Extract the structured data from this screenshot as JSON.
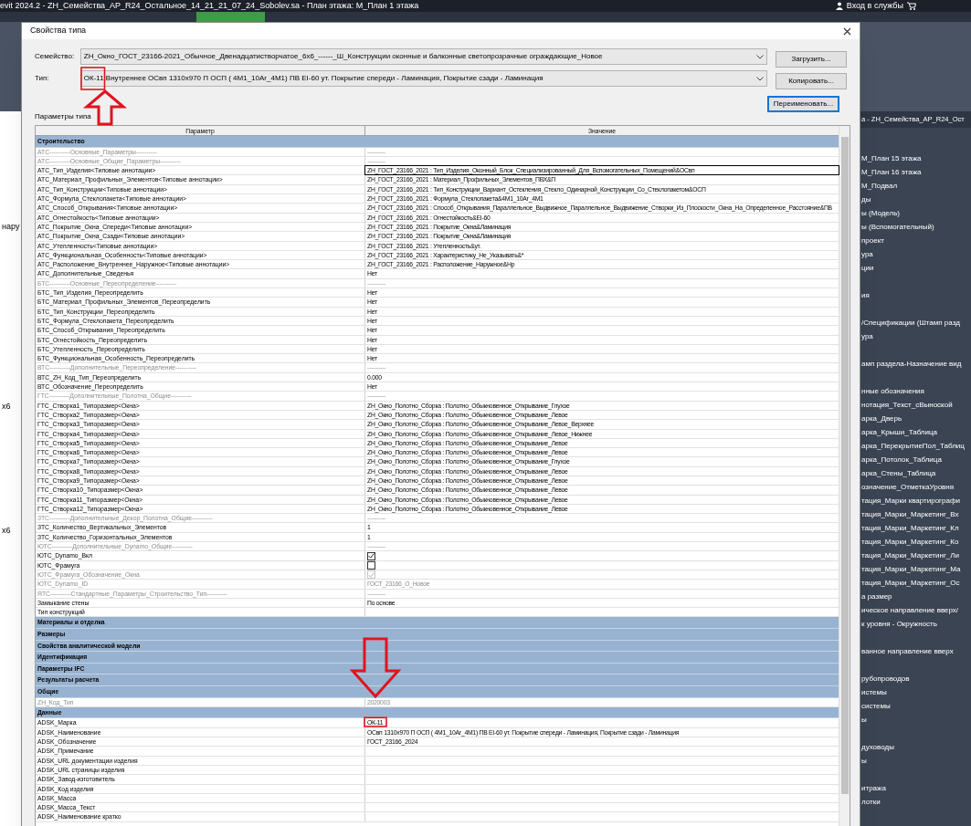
{
  "app": {
    "title": "evit 2024.2 - ZH_Семейства_АР_R24_Остальное_14_21_21_07_24_Sobolev.sa - План этажа: М_План 1 этажа",
    "sign_in": "Вход в службы"
  },
  "canvas": {
    "labels": [
      "нару",
      "х6",
      "х6"
    ]
  },
  "project_browser": {
    "header": "a - ZH_Семейства_АР_R24_Ост",
    "sections": [
      [
        "М_План 15 этажа",
        "М_План 16 этажа",
        "М_Подвал",
        "ды",
        "ы (Модель)",
        "ы (Вспомогательный)",
        "проект",
        "ура",
        "ции"
      ],
      [
        "ия"
      ],
      [
        "/Спецификации (Штамп разд",
        "ура"
      ],
      [
        "амп раздела-Назначение вид"
      ],
      [
        "нные обозначения",
        "нотация_Текст_сВыноской",
        "арка_Дверь",
        "арка_Крыши_Таблица",
        "арка_ПерекрытиеПол_Таблиц",
        "арка_Потолок_Таблица",
        "арка_Стены_Таблица",
        "означение_ОтметкаУровня",
        "тация_Марки квартирографи",
        "тация_Марки_Маркетинг_Вх",
        "тация_Марки_Маркетинг_Кл",
        "тация_Марки_Маркетинг_Ко",
        "тация_Марки_Маркетинг_Ли",
        "тация_Марки_Маркетинг_Ма",
        "тация_Марки_Маркетинг_Ос",
        "а размер",
        "ическое направление вверх/",
        "к уровня - Окружность"
      ],
      [
        "ванное направление вверх"
      ],
      [
        "рубопроводов",
        "истемы",
        "системы",
        "ы"
      ],
      [
        "духоводы",
        "ы"
      ],
      [
        "итража",
        "лотки"
      ]
    ]
  },
  "dialog": {
    "title": "Свойства типа",
    "family": {
      "label": "Семейство:",
      "value": "ZH_Окно_ГОСТ_23166-2021_Обычное_Двенадцатистворчатое_6х6_------_Ш_Конструкции оконные и балконные светопрозрачные ограждающие_Новое"
    },
    "type": {
      "label": "Тип:",
      "value": "ОК-11 Внутреннее ОСвп 1310х970 П ОСП ( 4М1_10Ar_4М1) ПВ EI-60 ут.  Покрытие спереди - Ламинация, Покрытие сзади - Ламинация"
    },
    "buttons": [
      {
        "label": "Загрузить...",
        "default": false
      },
      {
        "label": "Копировать...",
        "default": false
      },
      {
        "label": "Переименовать...",
        "default": true
      }
    ],
    "params_label": "Параметры типа",
    "columns": [
      "Параметр",
      "Значение"
    ],
    "rows": [
      {
        "kind": "group",
        "label": "Строительство",
        "selected": false
      },
      {
        "kind": "param",
        "name": "АТС----------Основные_Параметры----------",
        "value": "----------",
        "dim": true,
        "selected": false
      },
      {
        "kind": "param",
        "name": "АТС----------Основные_Общие_Параметры----------",
        "value": "----------",
        "dim": true,
        "selected": false
      },
      {
        "kind": "param",
        "name": "АТС_Тип_Изделия<Типовые аннотации>",
        "value": "ZH_ГОСТ_23166_2021 : Тип_Изделия_Оконный_Блок_Специализированный_Для_Вспомогательных_Помещений&ОСвп",
        "dim": false,
        "selected": true
      },
      {
        "kind": "param",
        "name": "АТС_Материал_Профильных_Элементов<Типовые аннотации>",
        "value": "ZH_ГОСТ_23166_2021 : Материал_Профильных_Элементов_ПВХ&П",
        "dim": false,
        "selected": false
      },
      {
        "kind": "param",
        "name": "АТС_Тип_Конструкции<Типовые аннотации>",
        "value": "ZH_ГОСТ_23166_2021 : Тип_Конструкции_Вариант_Остекления_Стекло_Одинарной_Конструкции_Со_Стеклопакетом&ОСП",
        "dim": false,
        "selected": false
      },
      {
        "kind": "param",
        "name": "АТС_Формула_Стеклопакета<Типовые аннотации>",
        "value": "ZH_ГОСТ_23166_2021 : Формула_Стеклопакета&4М1_10Ar_4М1",
        "dim": false,
        "selected": false
      },
      {
        "kind": "param",
        "name": "АТС_Способ_Открывания<Типовые аннотации>",
        "value": "ZH_ГОСТ_23166_2021 : Способ_Открывания_Параллельное_Выдвижное_Параллельное_Выдвижение_Створки_Из_Плоскости_Окна_На_Определенное_Расстояние&ПВ",
        "dim": false,
        "selected": false
      },
      {
        "kind": "param",
        "name": "АТС_Огнестойкость<Типовые аннотации>",
        "value": "ZH_ГОСТ_23166_2021 : Огнестойкость&EI-60",
        "dim": false,
        "selected": false
      },
      {
        "kind": "param",
        "name": "АТС_Покрытие_Окна_Спереди<Типовые аннотации>",
        "value": "ZH_ГОСТ_23166_2021 : Покрытие_Окна&Ламинация",
        "dim": false,
        "selected": false
      },
      {
        "kind": "param",
        "name": "АТС_Покрытие_Окна_Сзади<Типовые аннотации>",
        "value": "ZH_ГОСТ_23166_2021 : Покрытие_Окна&Ламинация",
        "dim": false,
        "selected": false
      },
      {
        "kind": "param",
        "name": "АТС_Утепленность<Типовые аннотации>",
        "value": "ZH_ГОСТ_23166_2021 : Утепленность&ут.",
        "dim": false,
        "selected": false
      },
      {
        "kind": "param",
        "name": "АТС_Функциональная_Особенность<Типовые аннотации>",
        "value": "ZH_ГОСТ_23166_2021 : Характеристику_Не_Указывать&*",
        "dim": false,
        "selected": false
      },
      {
        "kind": "param",
        "name": "АТС_Расположение_Внутреннее_Наружное<Типовые аннотации>",
        "value": "ZH_ГОСТ_23166_2021 : Расположение_Наружное&Нр",
        "dim": false,
        "selected": false
      },
      {
        "kind": "param",
        "name": "АТС_Дополнительные_Сведенья",
        "value": "Нет",
        "dim": false,
        "selected": false
      },
      {
        "kind": "param",
        "name": "БТС----------Основные_Переопределение----------",
        "value": "----------",
        "dim": true,
        "selected": false
      },
      {
        "kind": "param",
        "name": "БТС_Тип_Изделия_Переопределить",
        "value": "Нет",
        "dim": false,
        "selected": false
      },
      {
        "kind": "param",
        "name": "БТС_Материал_Профильных_Элементов_Переопределить",
        "value": "Нет",
        "dim": false,
        "selected": false
      },
      {
        "kind": "param",
        "name": "БТС_Тип_Конструкции_Переопределить",
        "value": "Нет",
        "dim": false,
        "selected": false
      },
      {
        "kind": "param",
        "name": "БТС_Формула_Стеклопакета_Переопределить",
        "value": "Нет",
        "dim": false,
        "selected": false
      },
      {
        "kind": "param",
        "name": "БТС_Способ_Открывания_Переопределить",
        "value": "Нет",
        "dim": false,
        "selected": false
      },
      {
        "kind": "param",
        "name": "БТС_Огнестойкость_Переопределить",
        "value": "Нет",
        "dim": false,
        "selected": false
      },
      {
        "kind": "param",
        "name": "БТС_Утепленность_Переопределить",
        "value": "Нет",
        "dim": false,
        "selected": false
      },
      {
        "kind": "param",
        "name": "БТС_Функциональная_Особенность_Переопределить",
        "value": "Нет",
        "dim": false,
        "selected": false
      },
      {
        "kind": "param",
        "name": "ВТС----------Дополнительные_Переопределение----------",
        "value": "----------",
        "dim": true,
        "selected": false
      },
      {
        "kind": "param",
        "name": "ВТС_ZH_Код_Тип_Переопределить",
        "value": "0.000",
        "dim": false,
        "selected": false
      },
      {
        "kind": "param",
        "name": "ВТС_Обозначение_Переопределить",
        "value": "Нет",
        "dim": false,
        "selected": false
      },
      {
        "kind": "param",
        "name": "ГТС----------Дополнительные_Полотна_Общие----------",
        "value": "----------",
        "dim": true,
        "selected": false
      },
      {
        "kind": "param",
        "name": "ГТС_Створка1_Типоразмер<Окна>",
        "value": "ZH_Окно_Полотно_Сборка : Полотно_Обыкновенное_Открывание_Глухое",
        "dim": false,
        "selected": false
      },
      {
        "kind": "param",
        "name": "ГТС_Створка2_Типоразмер<Окна>",
        "value": "ZH_Окно_Полотно_Сборка : Полотно_Обыкновенное_Открывание_Левое",
        "dim": false,
        "selected": false
      },
      {
        "kind": "param",
        "name": "ГТС_Створка3_Типоразмер<Окна>",
        "value": "ZH_Окно_Полотно_Сборка : Полотно_Обыкновенное_Открывание_Левое_Верхнее",
        "dim": false,
        "selected": false
      },
      {
        "kind": "param",
        "name": "ГТС_Створка4_Типоразмер<Окна>",
        "value": "ZH_Окно_Полотно_Сборка : Полотно_Обыкновенное_Открывание_Левое_Нижнее",
        "dim": false,
        "selected": false
      },
      {
        "kind": "param",
        "name": "ГТС_Створка5_Типоразмер<Окна>",
        "value": "ZH_Окно_Полотно_Сборка : Полотно_Обыкновенное_Открывание_Левое",
        "dim": false,
        "selected": false
      },
      {
        "kind": "param",
        "name": "ГТС_Створка6_Типоразмер<Окна>",
        "value": "ZH_Окно_Полотно_Сборка : Полотно_Обыкновенное_Открывание_Левое",
        "dim": false,
        "selected": false
      },
      {
        "kind": "param",
        "name": "ГТС_Створка7_Типоразмер<Окна>",
        "value": "ZH_Окно_Полотно_Сборка : Полотно_Обыкновенное_Открывание_Глухое",
        "dim": false,
        "selected": false
      },
      {
        "kind": "param",
        "name": "ГТС_Створка8_Типоразмер<Окна>",
        "value": "ZH_Окно_Полотно_Сборка : Полотно_Обыкновенное_Открывание_Левое",
        "dim": false,
        "selected": false
      },
      {
        "kind": "param",
        "name": "ГТС_Створка9_Типоразмер<Окна>",
        "value": "ZH_Окно_Полотно_Сборка : Полотно_Обыкновенное_Открывание_Левое",
        "dim": false,
        "selected": false
      },
      {
        "kind": "param",
        "name": "ГТС_Створка10_Типоразмер<Окна>",
        "value": "ZH_Окно_Полотно_Сборка : Полотно_Обыкновенное_Открывание_Левое",
        "dim": false,
        "selected": false
      },
      {
        "kind": "param",
        "name": "ГТС_Створка11_Типоразмер<Окна>",
        "value": "ZH_Окно_Полотно_Сборка : Полотно_Обыкновенное_Открывание_Левое",
        "dim": false,
        "selected": false
      },
      {
        "kind": "param",
        "name": "ГТС_Створка12_Типоразмер<Окна>",
        "value": "ZH_Окно_Полотно_Сборка : Полотно_Обыкновенное_Открывание_Левое",
        "dim": false,
        "selected": false
      },
      {
        "kind": "param",
        "name": "ЗТС----------Дополнительные_Декор_Полотна_Общие----------",
        "value": "----------",
        "dim": true,
        "selected": false
      },
      {
        "kind": "param",
        "name": "ЗТС_Количество_Вертикальных_Элементов",
        "value": "1",
        "dim": false,
        "selected": false
      },
      {
        "kind": "param",
        "name": "ЗТС_Количество_Горизонтальных_Элементов",
        "value": "1",
        "dim": false,
        "selected": false
      },
      {
        "kind": "param",
        "name": "ЮТС----------Дополнительные_Dynamo_Общие----------",
        "value": "----------",
        "dim": true,
        "selected": false
      },
      {
        "kind": "check",
        "name": "ЮТС_Dynamo_Вкл",
        "checked": true,
        "dim": false,
        "selected": false
      },
      {
        "kind": "check",
        "name": "ЮТС_Фрамуга",
        "checked": false,
        "dim": false,
        "selected": false
      },
      {
        "kind": "check",
        "name": "ЮТС_Фрамуга_Обозначение_Окна",
        "checked": true,
        "dim": true,
        "selected": false
      },
      {
        "kind": "param",
        "name": "ЮТС_Dynamo_ID",
        "value": "ГОСТ_23166_О_Новое",
        "dim": true,
        "selected": false
      },
      {
        "kind": "param",
        "name": "ЯТС----------Стандартные_Параметры_Строительство_Тип----------",
        "value": "----------",
        "dim": true,
        "selected": false
      },
      {
        "kind": "param",
        "name": "Замыкание стены",
        "value": "По основе",
        "dim": false,
        "selected": false
      },
      {
        "kind": "param",
        "name": "Тип конструкций",
        "dim": false,
        "selected": false
      },
      {
        "kind": "group",
        "label": "Материалы и отделка",
        "selected": false
      },
      {
        "kind": "group",
        "label": "Размеры",
        "selected": false
      },
      {
        "kind": "group",
        "label": "Свойства аналитической модели",
        "selected": false
      },
      {
        "kind": "group",
        "label": "Идентификация",
        "selected": false
      },
      {
        "kind": "group",
        "label": "Параметры IFC",
        "selected": false
      },
      {
        "kind": "group",
        "label": "Результаты расчета",
        "selected": false
      },
      {
        "kind": "group",
        "label": "Общие",
        "selected": false
      },
      {
        "kind": "param",
        "name": "ZH_Код_Тип",
        "value": "2020003",
        "dim": true,
        "selected": false
      },
      {
        "kind": "group",
        "label": "Данные",
        "selected": false
      },
      {
        "kind": "param",
        "name": "ADSK_Марка",
        "value": "ОК-11",
        "dim": false,
        "selected": false
      },
      {
        "kind": "param",
        "name": "ADSK_Наименование",
        "value": "ОСвп 1310х970 П ОСП ( 4М1_10Ar_4М1) ПВ EI-60 ут.  Покрытие спереди - Ламинация, Покрытие сзади - Ламинация",
        "dim": false,
        "selected": false
      },
      {
        "kind": "param",
        "name": "ADSK_Обозначение",
        "value": "ГОСТ_23166_2024",
        "dim": false,
        "selected": false
      },
      {
        "kind": "param",
        "name": "ADSK_Примечание",
        "dim": false,
        "selected": false
      },
      {
        "kind": "param",
        "name": "ADSK_URL документации изделия",
        "dim": false,
        "selected": false
      },
      {
        "kind": "param",
        "name": "ADSK_URL страницы изделия",
        "dim": false,
        "selected": false
      },
      {
        "kind": "param",
        "name": "ADSK_Завод-изготовитель",
        "dim": false,
        "selected": false
      },
      {
        "kind": "param",
        "name": "ADSK_Код изделия",
        "dim": false,
        "selected": false
      },
      {
        "kind": "param",
        "name": "ADSK_Масса",
        "dim": false,
        "selected": false
      },
      {
        "kind": "param",
        "name": "ADSK_Масса_Текст",
        "dim": false,
        "selected": false
      },
      {
        "kind": "param",
        "name": "ADSK_Наименование кратко",
        "dim": false,
        "selected": false
      }
    ]
  }
}
